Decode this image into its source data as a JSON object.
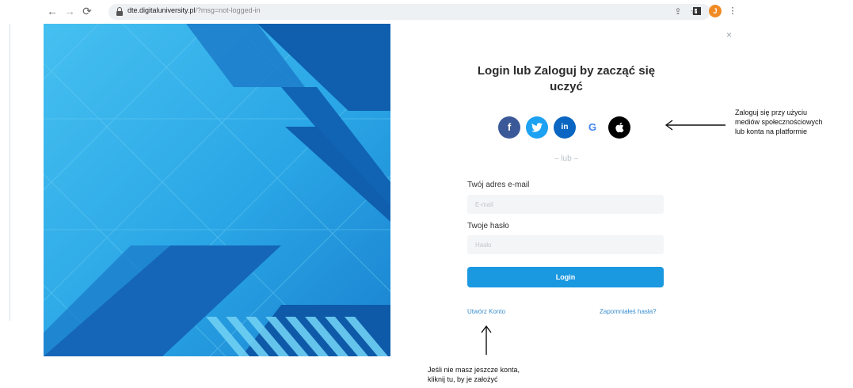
{
  "browser": {
    "url_host": "dte.digitaluniversity.pl",
    "url_path": "/?msg=not-logged-in",
    "back_icon": "arrow-left-icon",
    "forward_icon": "arrow-right-icon",
    "reload_icon": "reload-icon",
    "profile_initial": "J"
  },
  "login": {
    "title": "Login lub Zaloguj by zacząć się uczyć",
    "close_glyph": "×",
    "social": [
      {
        "name": "facebook",
        "glyph": "f",
        "color": "#3b5998"
      },
      {
        "name": "twitter",
        "glyph": "🐦",
        "color": "#1da1f2"
      },
      {
        "name": "linkedin",
        "glyph": "in",
        "color": "#0a66c2"
      },
      {
        "name": "google",
        "glyph": "G",
        "color": "#4285f4"
      },
      {
        "name": "apple",
        "glyph": "",
        "color": "#000000"
      }
    ],
    "or_separator": "– lub –",
    "email_label": "Twój adres e-mail",
    "email_placeholder": "E-mail",
    "password_label": "Twoje hasło",
    "password_placeholder": "Hasło",
    "login_button": "Login",
    "create_account_link": "Utwórz Konto",
    "forgot_password_link": "Zapomniałeś hasła?"
  },
  "annotations": {
    "social_line1": "Zaloguj się przy użyciu",
    "social_line2": "mediów społecznościowych",
    "social_line3": "lub konta na platformie",
    "create_line1": "Jeśli nie masz jeszcze konta,",
    "create_line2": "kliknij tu, by je założyć"
  },
  "colors": {
    "primary": "#1a98e0",
    "hero_light": "#3bb3ea",
    "hero_dark": "#0f5fae"
  }
}
